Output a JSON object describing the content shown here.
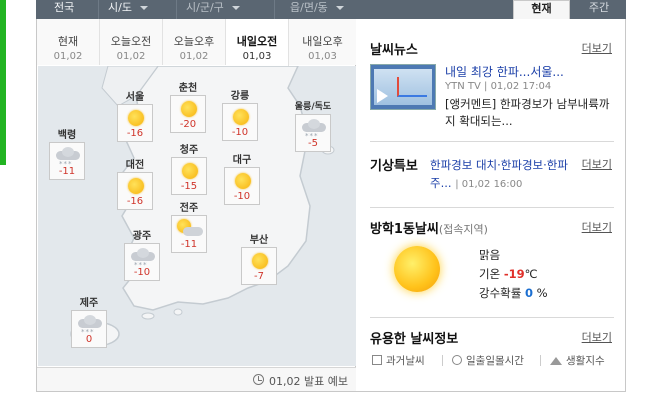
{
  "nav": {
    "country": "전국",
    "province": "시/도",
    "city": "시/군/구",
    "town": "읍/면/동",
    "tab_now": "현재",
    "tab_week": "주간"
  },
  "time_tabs": [
    {
      "label": "현재",
      "date": "01,02"
    },
    {
      "label": "오늘오전",
      "date": "01,02"
    },
    {
      "label": "오늘오후",
      "date": "01,02"
    },
    {
      "label": "내일오전",
      "date": "01,03"
    },
    {
      "label": "내일오후",
      "date": "01,03"
    }
  ],
  "stations": {
    "seoul": {
      "name": "서울",
      "temp": "-16",
      "icon": "sun-icon"
    },
    "chuncheon": {
      "name": "춘천",
      "temp": "-20",
      "icon": "sun-icon"
    },
    "gangneung": {
      "name": "강릉",
      "temp": "-10",
      "icon": "sun-icon"
    },
    "ulleung": {
      "name": "울릉/독도",
      "temp": "-5",
      "icon": "snow-icon"
    },
    "baengnyeong": {
      "name": "백령",
      "temp": "-11",
      "icon": "snow-icon"
    },
    "daejeon": {
      "name": "대전",
      "temp": "-16",
      "icon": "sun-icon"
    },
    "cheongju": {
      "name": "청주",
      "temp": "-15",
      "icon": "sun-icon"
    },
    "daegu": {
      "name": "대구",
      "temp": "-10",
      "icon": "sun-icon"
    },
    "jeonju": {
      "name": "전주",
      "temp": "-11",
      "icon": "sun-cloud-icon"
    },
    "gwangju": {
      "name": "광주",
      "temp": "-10",
      "icon": "snow-icon"
    },
    "busan": {
      "name": "부산",
      "temp": "-7",
      "icon": "sun-icon"
    },
    "jeju": {
      "name": "제주",
      "temp": "0",
      "icon": "snow-icon"
    }
  },
  "map_footer": "01,02 발표 예보",
  "news": {
    "title": "날씨뉴스",
    "more": "더보기",
    "headline": "내일 최강 한파...서울...",
    "source": "YTN TV",
    "time": "01,02 17:04",
    "sub": "[앵커멘트] 한파경보가 남부내륙까지 확대되는..."
  },
  "warning": {
    "title": "기상특보",
    "more": "더보기",
    "text": "한파경보 대치·한파경보·한파주...",
    "time": "01,02 16:00"
  },
  "local": {
    "title": "방학1동날씨",
    "subtitle": "(접속지역)",
    "more": "더보기",
    "condition": "맑음",
    "temp_label": "기온",
    "temp_value": "-19",
    "temp_unit": "℃",
    "rain_label": "강수확률",
    "rain_value": "0",
    "rain_unit": "%"
  },
  "info": {
    "title": "유용한 날씨정보",
    "more": "더보기",
    "links": [
      "과거날씨",
      "일출일몰시간",
      "생활지수"
    ]
  }
}
